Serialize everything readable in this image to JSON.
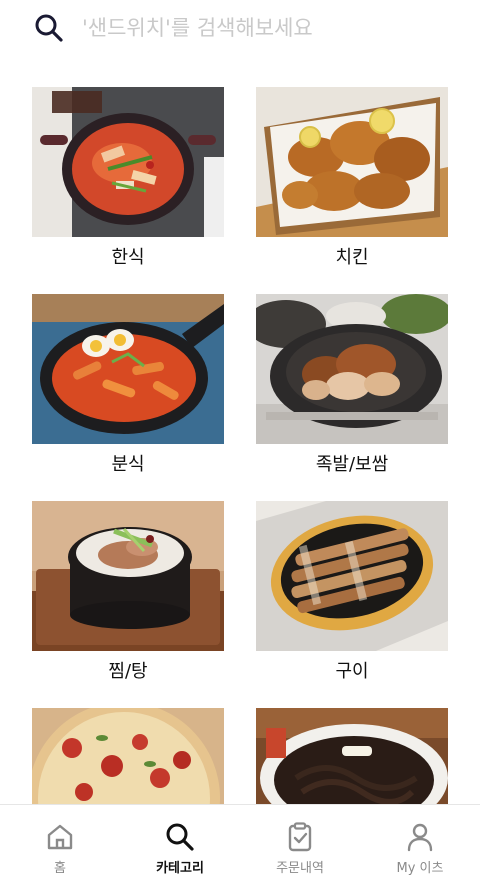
{
  "search": {
    "placeholder": "'샌드위치'를 검색해보세요",
    "icon": "search-icon"
  },
  "categories": [
    {
      "label": "한식",
      "image": "korean-stew-pot"
    },
    {
      "label": "치킨",
      "image": "fried-chicken-basket"
    },
    {
      "label": "분식",
      "image": "tteokbokki-pan"
    },
    {
      "label": "족발/보쌈",
      "image": "jokbal-plate"
    },
    {
      "label": "찜/탕",
      "image": "soup-stone-pot"
    },
    {
      "label": "구이",
      "image": "grilled-pork-pan"
    },
    {
      "label": "",
      "image": "pizza"
    },
    {
      "label": "",
      "image": "jajangmyeon-bowl"
    }
  ],
  "nav": {
    "items": [
      {
        "label": "홈",
        "icon": "home-icon",
        "active": false
      },
      {
        "label": "카테고리",
        "icon": "search-icon",
        "active": true
      },
      {
        "label": "주문내역",
        "icon": "clipboard-check-icon",
        "active": false
      },
      {
        "label": "My 이츠",
        "icon": "person-icon",
        "active": false
      }
    ]
  },
  "colors": {
    "active": "#111111",
    "inactive": "#8a8a8a",
    "placeholder": "#c9c9c9",
    "divider": "#e6e6e6"
  }
}
